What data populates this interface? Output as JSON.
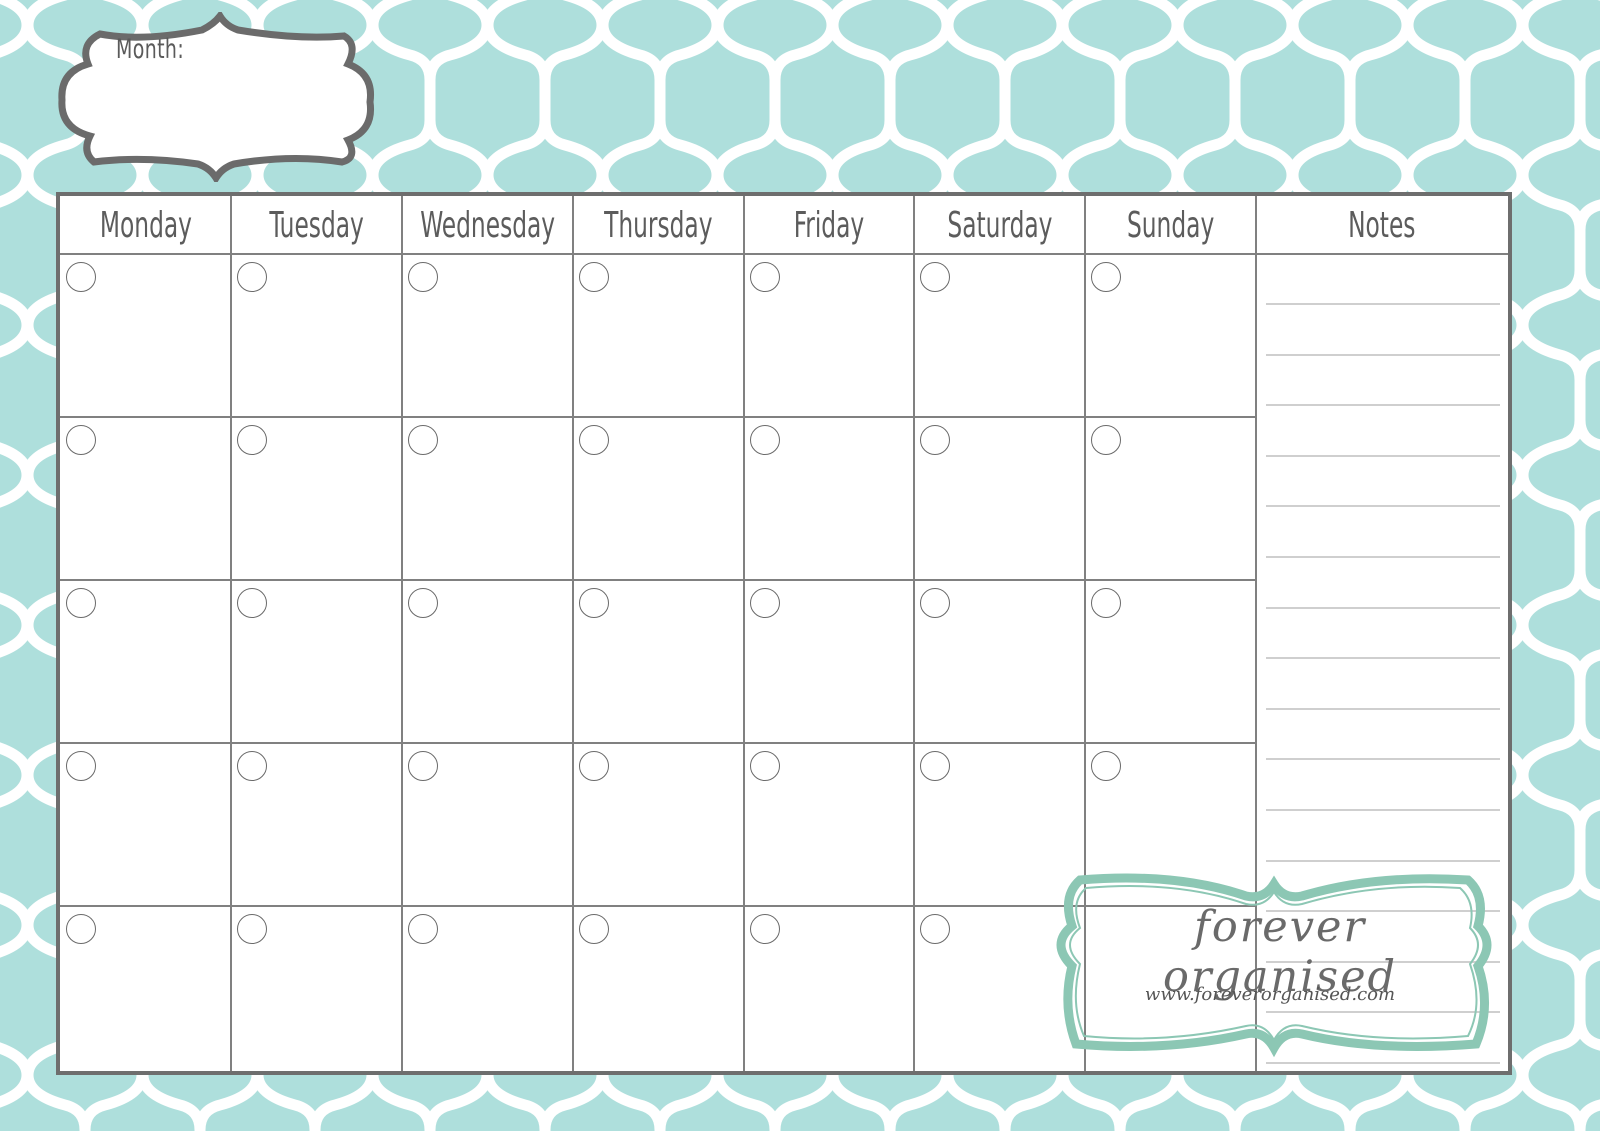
{
  "colors": {
    "pattern_fill": "#aedfdc",
    "pattern_lines": "#ffffff",
    "frame_border": "#6e6e6e",
    "grid_lines": "#808080",
    "text": "#5c5c5c",
    "notes_lines": "#cfcfcf",
    "brand_accent": "#8cc7b4"
  },
  "month": {
    "label": "Month:",
    "value": ""
  },
  "calendar": {
    "columns": [
      "Monday",
      "Tuesday",
      "Wednesday",
      "Thursday",
      "Friday",
      "Saturday",
      "Sunday"
    ],
    "notes_header": "Notes",
    "weeks": 5,
    "days_per_week": 7,
    "omitted_circles": [
      [
        4,
        6
      ]
    ],
    "notes_line_count": 16
  },
  "brand": {
    "name": "forever organised",
    "url": "www.foreverorganised.com"
  }
}
